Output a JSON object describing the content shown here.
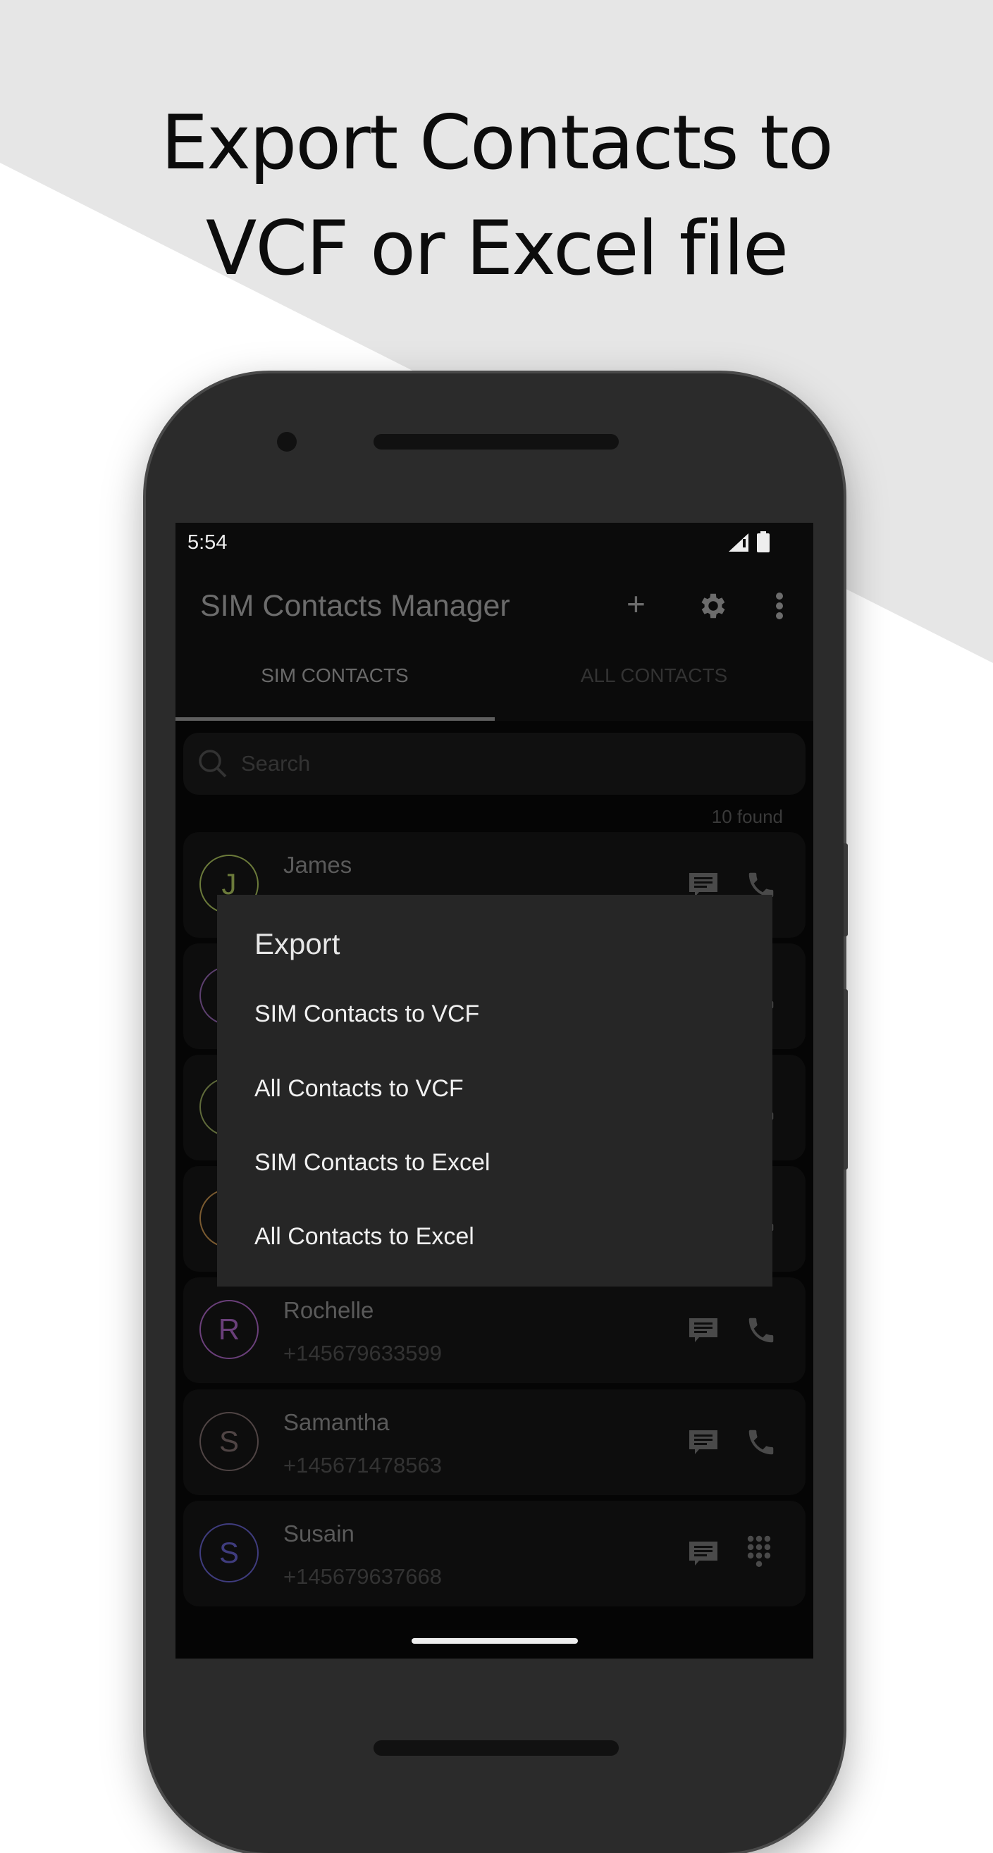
{
  "headline": {
    "line1": "Export Contacts to",
    "line2": "VCF or Excel file"
  },
  "status_bar": {
    "time": "5:54",
    "icons": [
      "signal-icon",
      "battery-icon"
    ]
  },
  "app_bar": {
    "title": "SIM Contacts Manager",
    "actions": [
      "plus-icon",
      "gear-icon",
      "more-vert-icon"
    ]
  },
  "tabs": [
    {
      "label": "SIM CONTACTS",
      "active": true
    },
    {
      "label": "ALL CONTACTS",
      "active": false
    }
  ],
  "search": {
    "placeholder": "Search"
  },
  "found_count": "10 found",
  "contacts": [
    {
      "initial": "J",
      "name": "James",
      "color": "#6b7a3a"
    },
    {
      "initial": "",
      "name": "",
      "color": "#5c3f6e"
    },
    {
      "initial": "",
      "name": "",
      "color": "#5f6a3a"
    },
    {
      "initial": "",
      "name": "",
      "color": "#7a5a30"
    },
    {
      "initial": "R",
      "name": "Rochelle",
      "phone": "+145679633599",
      "color": "#6a3f7a"
    },
    {
      "initial": "S",
      "name": "Samantha",
      "phone": "+145671478563",
      "color": "#4f4444"
    },
    {
      "initial": "S",
      "name": "Susain",
      "phone": "+145679637668",
      "color": "#3f3c7e"
    }
  ],
  "dialog": {
    "title": "Export",
    "items": [
      "SIM Contacts to VCF",
      "All Contacts to VCF",
      "SIM Contacts to Excel",
      "All Contacts to Excel"
    ]
  }
}
